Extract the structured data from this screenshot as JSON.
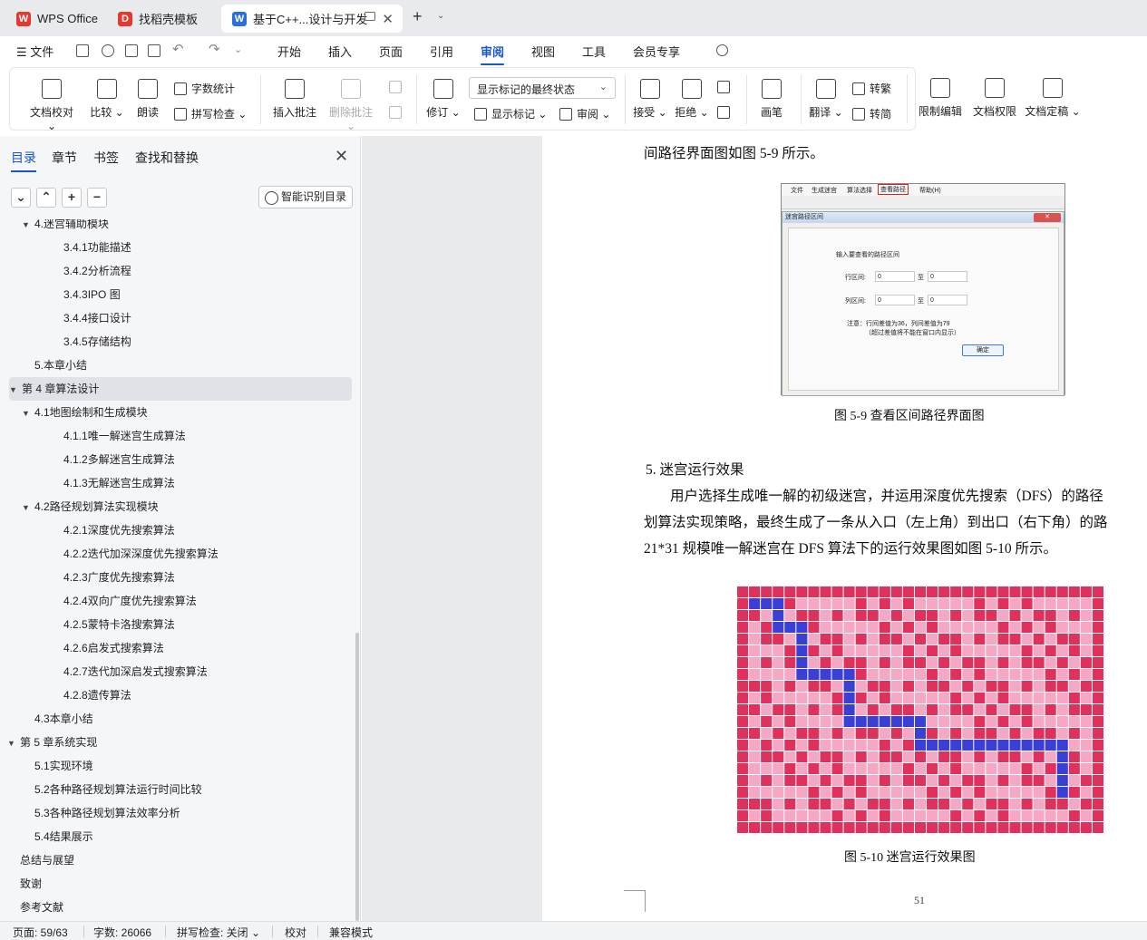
{
  "tabs": [
    {
      "label": "WPS Office",
      "icon": "wps-logo-icon",
      "color": "#e5392e"
    },
    {
      "label": "找稻壳模板",
      "icon": "docer-logo-icon",
      "color": "#e5392e"
    },
    {
      "label": "基于C++...设计与开发",
      "icon": "word-doc-icon",
      "color": "#2b6fdc"
    }
  ],
  "menu": {
    "file": "文件",
    "items": [
      "开始",
      "插入",
      "页面",
      "引用",
      "审阅",
      "视图",
      "工具",
      "会员专享"
    ],
    "active": "审阅"
  },
  "ribbon": {
    "doc_check": "文档校对",
    "compare": "比较",
    "read_aloud": "朗读",
    "word_count": "字数统计",
    "spell_check": "拼写检查",
    "insert_comment": "插入批注",
    "delete_comment": "删除批注",
    "revise": "修订",
    "mark_state": "显示标记的最终状态",
    "show_marks": "显示标记",
    "review": "审阅",
    "accept": "接受",
    "reject": "拒绝",
    "ink": "画笔",
    "translate": "翻译",
    "to_traditional": "转繁",
    "to_simplified": "转简",
    "restrict_edit": "限制编辑",
    "doc_permission": "文档权限",
    "doc_finalize": "文档定稿"
  },
  "nav": {
    "tabs": [
      "目录",
      "章节",
      "书签",
      "查找和替换"
    ],
    "smart_toc": "智能识别目录",
    "toc": [
      {
        "label": "4.迷宫辅助模块",
        "level": 2,
        "arrow": true
      },
      {
        "label": "3.4.1功能描述",
        "level": 3
      },
      {
        "label": "3.4.2分析流程",
        "level": 3
      },
      {
        "label": "3.4.3IPO 图",
        "level": 3
      },
      {
        "label": "3.4.4接口设计",
        "level": 3
      },
      {
        "label": "3.4.5存储结构",
        "level": 3
      },
      {
        "label": "5.本章小结",
        "level": 2
      },
      {
        "label": "第 4 章算法设计",
        "level": 1,
        "arrow": true,
        "selected": true
      },
      {
        "label": "4.1地图绘制和生成模块",
        "level": 2,
        "arrow": true
      },
      {
        "label": "4.1.1唯一解迷宫生成算法",
        "level": 3
      },
      {
        "label": "4.1.2多解迷宫生成算法",
        "level": 3
      },
      {
        "label": "4.1.3无解迷宫生成算法",
        "level": 3
      },
      {
        "label": "4.2路径规划算法实现模块",
        "level": 2,
        "arrow": true
      },
      {
        "label": "4.2.1深度优先搜索算法",
        "level": 3
      },
      {
        "label": "4.2.2迭代加深深度优先搜索算法",
        "level": 3
      },
      {
        "label": "4.2.3广度优先搜索算法",
        "level": 3
      },
      {
        "label": "4.2.4双向广度优先搜索算法",
        "level": 3
      },
      {
        "label": "4.2.5蒙特卡洛搜索算法",
        "level": 3
      },
      {
        "label": "4.2.6启发式搜索算法",
        "level": 3
      },
      {
        "label": "4.2.7迭代加深启发式搜索算法",
        "level": 3
      },
      {
        "label": "4.2.8遗传算法",
        "level": 3
      },
      {
        "label": "4.3本章小结",
        "level": 2
      },
      {
        "label": "第 5 章系统实现",
        "level": 1,
        "arrow": true
      },
      {
        "label": "5.1实现环境",
        "level": 2
      },
      {
        "label": "5.2各种路径规划算法运行时间比较",
        "level": 2
      },
      {
        "label": "5.3各种路径规划算法效率分析",
        "level": 2
      },
      {
        "label": "5.4结果展示",
        "level": 2
      },
      {
        "label": "总结与展望",
        "level": 1
      },
      {
        "label": "致谢",
        "level": 1
      },
      {
        "label": "参考文献",
        "level": 1
      }
    ]
  },
  "document": {
    "line_top": "间路径界面图如图 5-9 所示。",
    "fig59": {
      "menu": [
        "文件",
        "生成迷宫",
        "算法选择",
        "查看路径",
        "帮助(H)"
      ],
      "dialog_title": "迷宫路径区间",
      "group_label": "输入要查看的路径区间",
      "row_label": "行区间:",
      "col_label": "列区间:",
      "to": "至",
      "row_from": "0",
      "row_to": "0",
      "col_from": "0",
      "col_to": "0",
      "note1": "注意：行间差值为36，列间差值为79",
      "note2": "（超过差值将不能在窗口内显示）",
      "ok": "确定"
    },
    "caption59": "图 5-9    查看区间路径界面图",
    "heading5": "5.   迷宫运行效果",
    "para": [
      "用户选择生成唯一解的初级迷宫，并运用深度优先搜索（DFS）的路径",
      "划算法实现策略，最终生成了一条从入口（左上角）到出口（右下角）的路",
      "21*31 规模唯一解迷宫在 DFS 算法下的运行效果图如图 5-10 所示。"
    ],
    "caption510": "图 5-10    迷宫运行效果图",
    "page_number": "51"
  },
  "colors": {
    "wall": "#e0305c",
    "floor": "#f5a8c4",
    "path": "#3a3fd6"
  },
  "status": {
    "page": "页面: 59/63",
    "words": "字数: 26066",
    "spell": "拼写检查: 关闭",
    "proof": "校对",
    "compat": "兼容模式"
  }
}
